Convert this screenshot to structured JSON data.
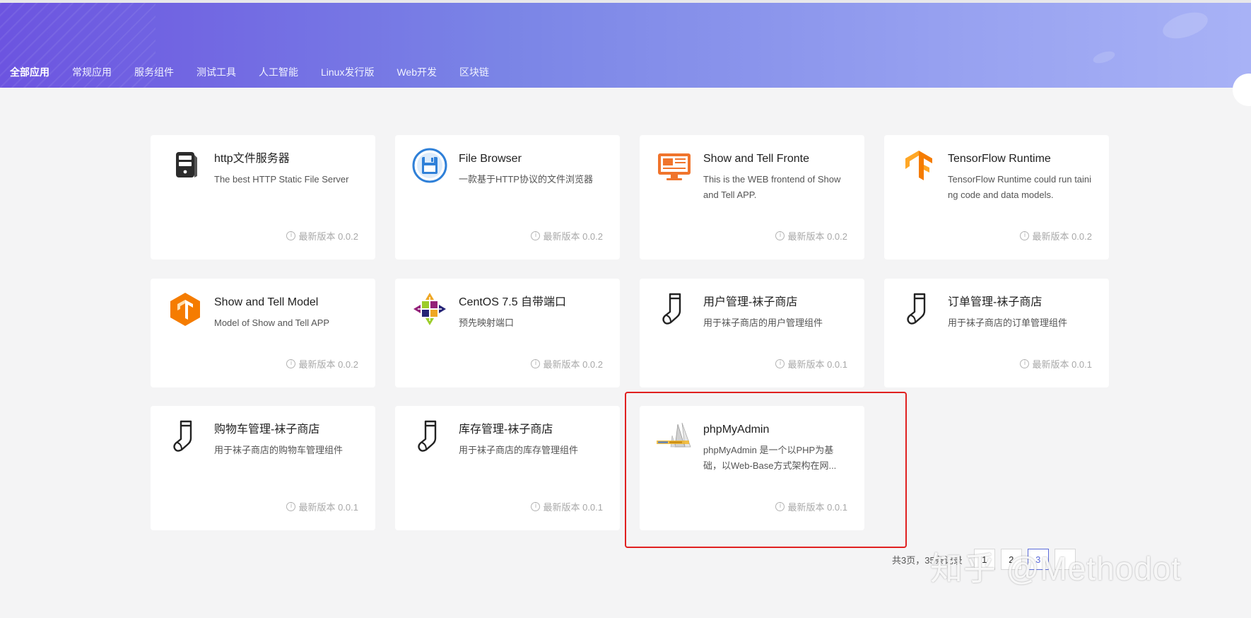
{
  "nav": {
    "tabs": [
      "全部应用",
      "常规应用",
      "服务组件",
      "测试工具",
      "人工智能",
      "Linux发行版",
      "Web开发",
      "区块链"
    ],
    "active_index": 0
  },
  "cards": [
    {
      "title": "http文件服务器",
      "desc": "The best HTTP Static File Server",
      "version": "最新版本 0.0.2",
      "icon": "server-icon"
    },
    {
      "title": "File Browser",
      "desc": "一款基于HTTP协议的文件浏览器",
      "version": "最新版本 0.0.2",
      "icon": "floppy-disk-icon"
    },
    {
      "title": "Show and Tell Fronte",
      "desc": "This is the WEB frontend of Show and Tell APP.",
      "version": "最新版本 0.0.2",
      "icon": "monitor-icon"
    },
    {
      "title": "TensorFlow Runtime",
      "desc": "TensorFlow Runtime could run taining code and data models.",
      "version": "最新版本 0.0.2",
      "icon": "tensorflow-icon"
    },
    {
      "title": "Show and Tell Model",
      "desc": "Model of Show and Tell APP",
      "version": "最新版本 0.0.2",
      "icon": "tensorflow-hexagon-icon"
    },
    {
      "title": "CentOS 7.5 自带端口",
      "desc": "预先映射端口",
      "version": "最新版本 0.0.2",
      "icon": "centos-icon"
    },
    {
      "title": "用户管理-袜子商店",
      "desc": "用于袜子商店的用户管理组件",
      "version": "最新版本 0.0.1",
      "icon": "sock-icon"
    },
    {
      "title": "订单管理-袜子商店",
      "desc": "用于袜子商店的订单管理组件",
      "version": "最新版本 0.0.1",
      "icon": "sock-icon"
    },
    {
      "title": "购物车管理-袜子商店",
      "desc": "用于袜子商店的购物车管理组件",
      "version": "最新版本 0.0.1",
      "icon": "sock-icon"
    },
    {
      "title": "库存管理-袜子商店",
      "desc": "用于袜子商店的库存管理组件",
      "version": "最新版本 0.0.1",
      "icon": "sock-icon"
    },
    {
      "title": "phpMyAdmin",
      "desc": "phpMyAdmin 是一个以PHP为基础，以Web-Base方式架构在网...",
      "version": "最新版本 0.0.1",
      "icon": "phpmyadmin-logo-icon"
    }
  ],
  "pagination": {
    "summary": "共3页，35条记录",
    "pages": [
      "1",
      "2",
      "3"
    ],
    "current_index": 2
  },
  "watermark": "知乎 @Methodot",
  "colors": {
    "accent": "#5b6bd9",
    "highlight": "#e02020",
    "banner_start": "#6c54e0",
    "banner_end": "#a8b2f6"
  }
}
